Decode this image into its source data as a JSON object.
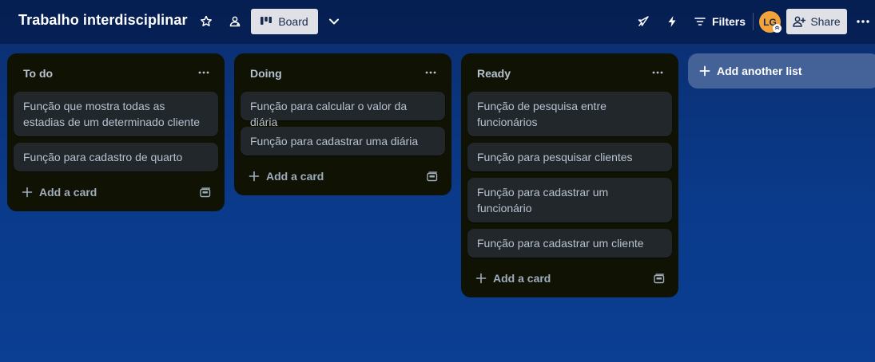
{
  "board": {
    "title": "Trabalho interdisciplinar",
    "view_label": "Board",
    "filters_label": "Filters",
    "share_label": "Share",
    "avatar_initials": "LG"
  },
  "icons": {
    "star": "star-icon",
    "team": "workspace-visible-icon",
    "board_view": "board-columns-icon",
    "chevron": "chevron-down-icon",
    "power_ups": "rocket-icon",
    "automation": "lightning-bolt-icon",
    "filters": "filter-lines-icon",
    "share": "add-member-icon",
    "more": "more-dots-icon",
    "list_menu": "more-dots-icon",
    "add": "plus-icon",
    "template": "card-template-icon"
  },
  "colors": {
    "list_bg": "#101204",
    "card_bg": "#22272b",
    "avatar_bg": "#f2a33a",
    "board_bg": "#0b3580"
  },
  "lists": [
    {
      "title": "To do",
      "cards": [
        "Função que mostra todas as estadias de um determinado cliente",
        "Função para cadastro de quarto"
      ],
      "add_card_label": "Add a card"
    },
    {
      "title": "Doing",
      "cards": [
        "Função para calcular o valor da diária",
        "Função para cadastrar uma diária"
      ],
      "add_card_label": "Add a card"
    },
    {
      "title": "Ready",
      "cards": [
        "Função de pesquisa entre funcionários",
        "Função para pesquisar clientes",
        "Função para cadastrar um funcionário",
        "Função para cadastrar um cliente"
      ],
      "add_card_label": "Add a card"
    }
  ],
  "add_list_label": "Add another list"
}
